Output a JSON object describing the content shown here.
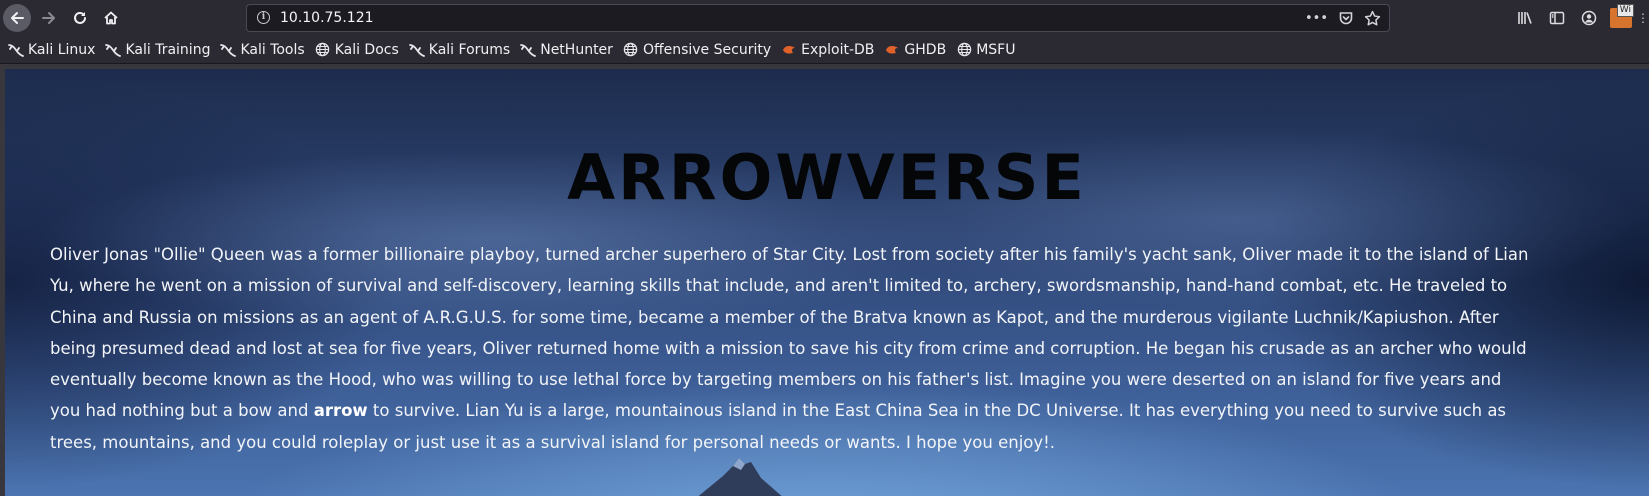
{
  "browser": {
    "url": "10.10.75.121",
    "nav": {
      "back_icon": "arrow-left-icon",
      "forward_icon": "arrow-right-icon",
      "reload_icon": "reload-icon",
      "home_icon": "home-icon"
    },
    "url_actions": {
      "more_label": "•••",
      "pocket_icon": "pocket-icon",
      "bookmark_icon": "star-icon"
    },
    "extension_badge": "Wi"
  },
  "bookmarks": [
    {
      "label": "Kali Linux",
      "icon": "kali-dragon-icon"
    },
    {
      "label": "Kali Training",
      "icon": "kali-dragon-icon"
    },
    {
      "label": "Kali Tools",
      "icon": "kali-dragon-icon"
    },
    {
      "label": "Kali Docs",
      "icon": "globe-icon"
    },
    {
      "label": "Kali Forums",
      "icon": "kali-dragon-icon"
    },
    {
      "label": "NetHunter",
      "icon": "kali-dragon-icon"
    },
    {
      "label": "Offensive Security",
      "icon": "globe-icon"
    },
    {
      "label": "Exploit-DB",
      "icon": "exploit-db-icon"
    },
    {
      "label": "GHDB",
      "icon": "exploit-db-icon"
    },
    {
      "label": "MSFU",
      "icon": "globe-icon"
    }
  ],
  "page": {
    "title": "ARROWVERSE",
    "text_before": "Oliver Jonas \"Ollie\" Queen was a former billionaire playboy, turned archer superhero of Star City. Lost from society after his family's yacht sank, Oliver made it to the island of Lian Yu, where he went on a mission of survival and self-discovery, learning skills that include, and aren't limited to, archery, swordsmanship, hand-hand combat, etc. He traveled to China and Russia on missions as an agent of A.R.G.U.S. for some time, became a member of the Bratva known as Kapot, and the murderous vigilante Luchnik/Kapiushon. After being presumed dead and lost at sea for five years, Oliver returned home with a mission to save his city from crime and corruption. He began his crusade as an archer who would eventually become known as the Hood, who was willing to use lethal force by targeting members on his father's list. Imagine you were deserted on an island for five years and you had nothing but a bow and ",
    "text_bold": "arrow",
    "text_after": " to survive. Lian Yu is a large, mountainous island in the East China Sea in the DC Universe. It has everything you need to survive such as trees, mountains, and you could roleplay or just use it as a survival island for personal needs or wants. I hope you enjoy!."
  }
}
